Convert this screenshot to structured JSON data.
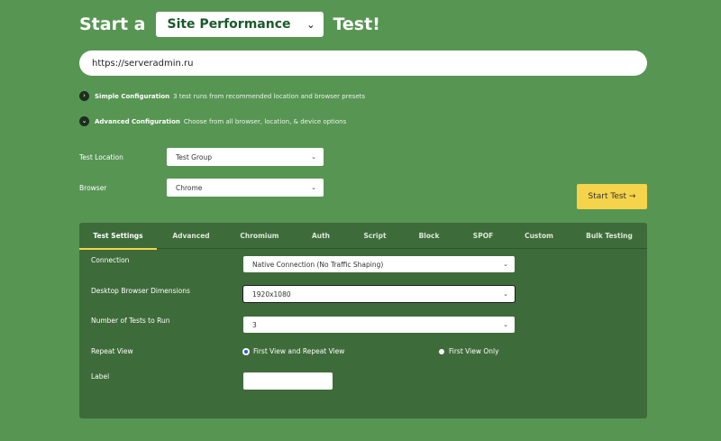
{
  "heading": {
    "prefix": "Start a",
    "test_type": "Site Performance",
    "suffix": "Test!"
  },
  "url": {
    "value": "https://serveradmin.ru"
  },
  "config": {
    "simple": {
      "title": "Simple Configuration",
      "desc": "3 test runs from recommended location and browser presets"
    },
    "advanced": {
      "title": "Advanced Configuration",
      "desc": "Choose from all browser, location, & device options"
    }
  },
  "form": {
    "location_label": "Test Location",
    "location_value": "Test Group",
    "browser_label": "Browser",
    "browser_value": "Chrome",
    "start_button": "Start Test →"
  },
  "tabs": [
    {
      "label": "Test Settings"
    },
    {
      "label": "Advanced"
    },
    {
      "label": "Chromium"
    },
    {
      "label": "Auth"
    },
    {
      "label": "Script"
    },
    {
      "label": "Block"
    },
    {
      "label": "SPOF"
    },
    {
      "label": "Custom"
    },
    {
      "label": "Bulk Testing"
    }
  ],
  "settings": {
    "connection_label": "Connection",
    "connection_value": "Native Connection (No Traffic Shaping)",
    "dimensions_label": "Desktop Browser Dimensions",
    "dimensions_value": "1920x1080",
    "runs_label": "Number of Tests to Run",
    "runs_value": "3",
    "repeat_label": "Repeat View",
    "repeat_option_1": "First View and Repeat View",
    "repeat_option_2": "First View Only",
    "label_label": "Label"
  },
  "colors": {
    "background": "#579553",
    "panel": "#3e6b3a",
    "accent": "#f5d34a"
  }
}
